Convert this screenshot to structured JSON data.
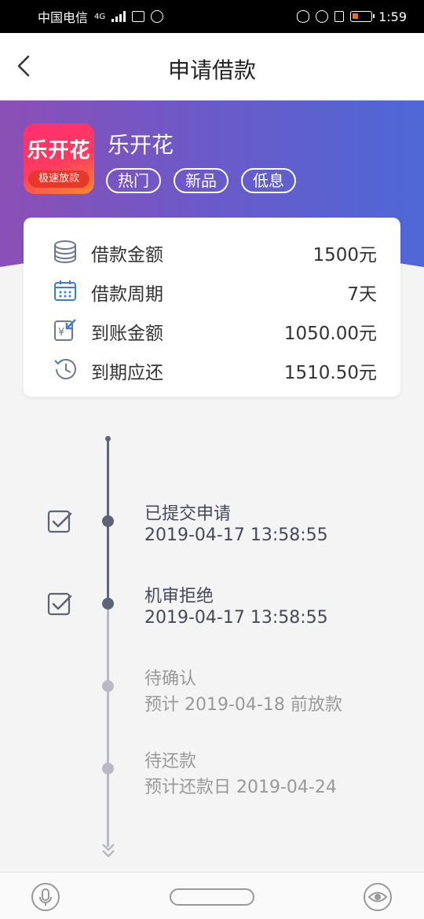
{
  "status_bar": {
    "carrier": "中国电信",
    "network": "4G",
    "time": "1:59"
  },
  "header": {
    "title": "申请借款",
    "back_icon": "chevron-left-icon"
  },
  "app": {
    "name": "乐开花",
    "logo_text": "乐开花",
    "logo_band": "极速放款",
    "tags": [
      "热门",
      "新品",
      "低息"
    ]
  },
  "summary": {
    "rows": [
      {
        "label": "借款金额",
        "value": "1500元",
        "icon": "coins-icon"
      },
      {
        "label": "借款周期",
        "value": "7天",
        "icon": "calendar-icon"
      },
      {
        "label": "到账金额",
        "value": "1050.00元",
        "icon": "receive-money-icon"
      },
      {
        "label": "到期应还",
        "value": "1510.50元",
        "icon": "clock-return-icon"
      }
    ]
  },
  "timeline": {
    "steps": [
      {
        "title": "已提交申请",
        "detail": "2019-04-17 13:58:55",
        "done": true
      },
      {
        "title": "机审拒绝",
        "detail": "2019-04-17 13:58:55",
        "done": true
      },
      {
        "title": "待确认",
        "detail": "预计 2019-04-18 前放款",
        "done": false
      },
      {
        "title": "待还款",
        "detail": "预计还款日 2019-04-24",
        "done": false
      }
    ]
  },
  "colors": {
    "gradient_start": "#8c4fb5",
    "gradient_end": "#4e68d6",
    "timeline_active": "#5e6379",
    "timeline_inactive": "#b7bac3"
  }
}
